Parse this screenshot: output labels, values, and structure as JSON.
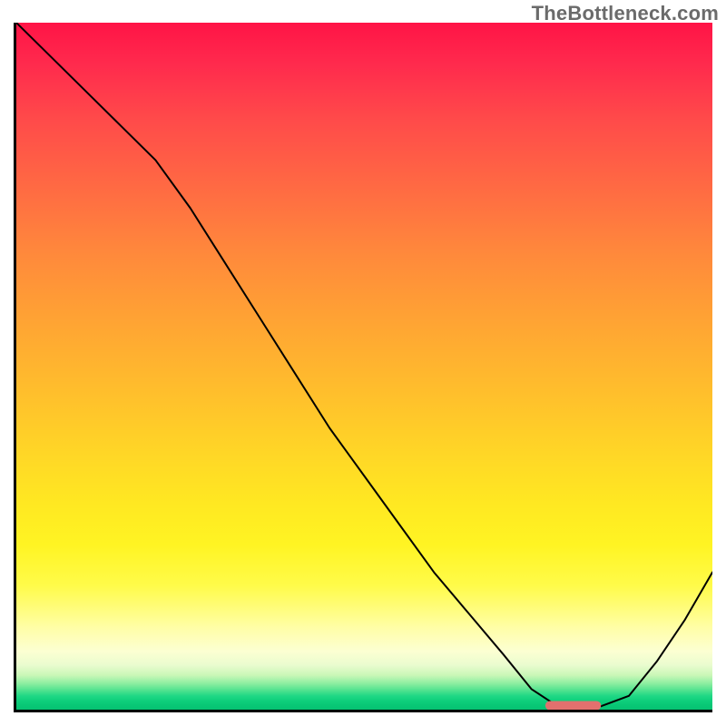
{
  "watermark": "TheBottleneck.com",
  "chart_data": {
    "type": "line",
    "title": "",
    "xlabel": "",
    "ylabel": "",
    "xlim": [
      0,
      100
    ],
    "ylim": [
      0,
      100
    ],
    "grid": false,
    "legend": false,
    "series": [
      {
        "name": "bottleneck-curve",
        "x": [
          0,
          5,
          10,
          15,
          20,
          25,
          30,
          35,
          40,
          45,
          50,
          55,
          60,
          65,
          70,
          74,
          77,
          80,
          84,
          88,
          92,
          96,
          100
        ],
        "y": [
          100,
          95,
          90,
          85,
          80,
          73,
          65,
          57,
          49,
          41,
          34,
          27,
          20,
          14,
          8,
          3,
          1,
          0.5,
          0.5,
          2,
          7,
          13,
          20
        ]
      }
    ],
    "marker": {
      "name": "optimal-range",
      "x_start": 76,
      "x_end": 84,
      "y": 0.6,
      "color": "#e2706e"
    },
    "background": {
      "direction": "vertical",
      "stops": [
        {
          "pos": 0.0,
          "color": "#ff1446"
        },
        {
          "pos": 0.24,
          "color": "#ff6a43"
        },
        {
          "pos": 0.54,
          "color": "#ffbf2c"
        },
        {
          "pos": 0.82,
          "color": "#fffb4a"
        },
        {
          "pos": 0.92,
          "color": "#fcffd2"
        },
        {
          "pos": 0.97,
          "color": "#4fe28f"
        },
        {
          "pos": 1.0,
          "color": "#06c172"
        }
      ]
    }
  }
}
